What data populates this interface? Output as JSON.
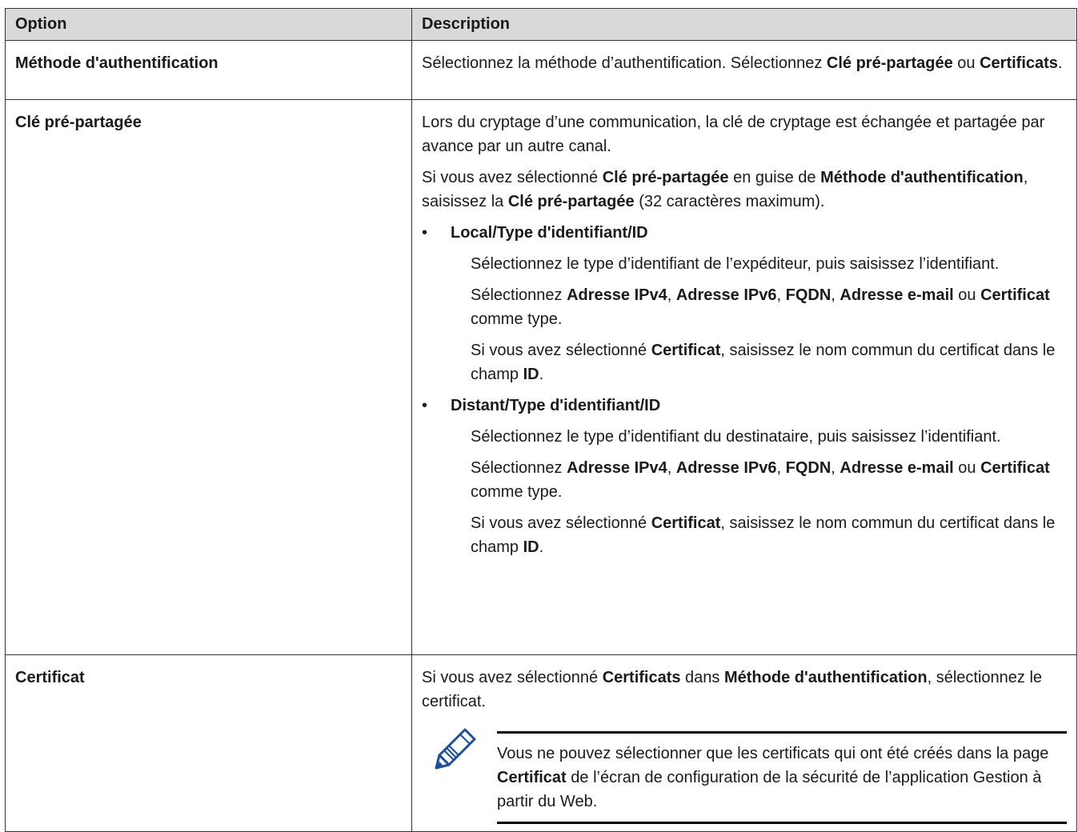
{
  "table": {
    "headers": {
      "option": "Option",
      "description": "Description"
    },
    "rows": [
      {
        "option": "Méthode d'authentification",
        "desc": {
          "p1": {
            "a": "Sélectionnez la méthode d’authentification. Sélectionnez ",
            "b": "Clé pré-partagée",
            "c": " ou ",
            "d": "Certificats",
            "e": "."
          }
        }
      },
      {
        "option": "Clé pré-partagée",
        "desc": {
          "p1": "Lors du cryptage d’une communication, la clé de cryptage est échangée et partagée par avance par un autre canal.",
          "p2": {
            "a": "Si vous avez sélectionné ",
            "b": "Clé pré-partagée",
            "c": " en guise de ",
            "d": "Méthode d'authentification",
            "e": ", saisissez la ",
            "f": "Clé pré-partagée",
            "g": " (32 caractères maximum)."
          },
          "bullet1": {
            "title": "Local/Type d'identifiant/ID",
            "s1": "Sélectionnez le type d’identifiant de l’expéditeur, puis saisissez l’identifiant.",
            "s2": {
              "a": "Sélectionnez ",
              "b": "Adresse IPv4",
              "c": ", ",
              "d": "Adresse IPv6",
              "e": ", ",
              "f": "FQDN",
              "g": ", ",
              "h": "Adresse e-mail",
              "i": " ou ",
              "j": "Certificat",
              "k": " comme type."
            },
            "s3": {
              "a": "Si vous avez sélectionné ",
              "b": "Certificat",
              "c": ", saisissez le nom commun du certificat dans le champ ",
              "d": "ID",
              "e": "."
            }
          },
          "bullet2": {
            "title": "Distant/Type d'identifiant/ID",
            "s1": "Sélectionnez le type d’identifiant du destinataire, puis saisissez l’identifiant.",
            "s2": {
              "a": "Sélectionnez ",
              "b": "Adresse IPv4",
              "c": ", ",
              "d": "Adresse IPv6",
              "e": ", ",
              "f": "FQDN",
              "g": ", ",
              "h": "Adresse e-mail",
              "i": " ou ",
              "j": "Certificat",
              "k": " comme type."
            },
            "s3": {
              "a": "Si vous avez sélectionné ",
              "b": "Certificat",
              "c": ", saisissez le nom commun du certificat dans le champ ",
              "d": "ID",
              "e": "."
            }
          },
          "bullet_char": "•"
        }
      },
      {
        "option": "Certificat",
        "desc": {
          "p1": {
            "a": "Si vous avez sélectionné ",
            "b": "Certificats",
            "c": " dans ",
            "d": "Méthode d'authentification",
            "e": ", sélectionnez le certificat."
          },
          "note": {
            "icon": "pencil-note-icon",
            "a": "Vous ne pouvez sélectionner que les certificats qui ont été créés dans la page ",
            "b": "Certificat",
            "c": " de l’écran de configuration de la sécurité de l’application Gestion à partir du Web."
          }
        }
      }
    ]
  }
}
